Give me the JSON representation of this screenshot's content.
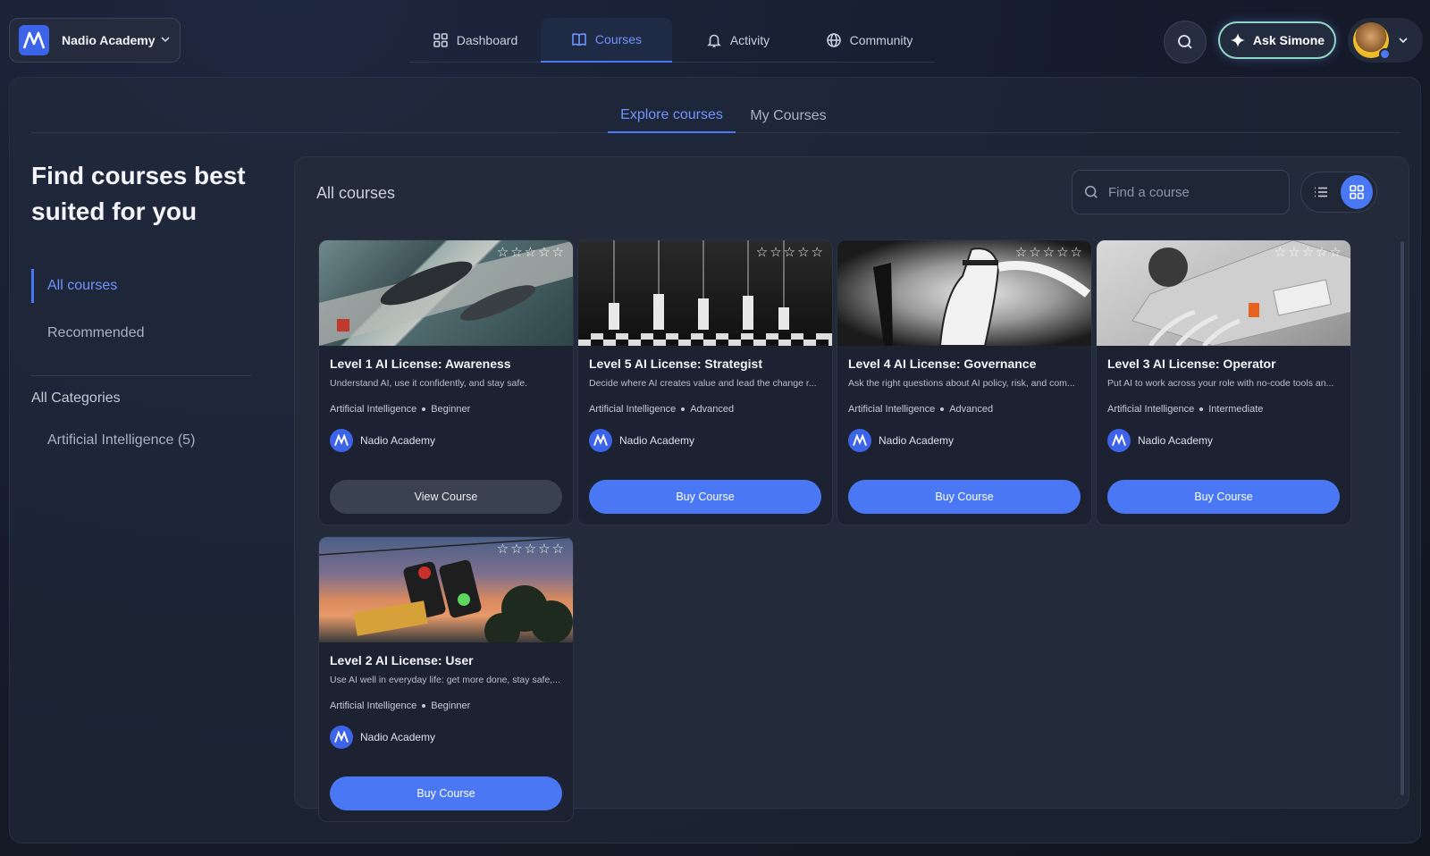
{
  "org": {
    "name": "Nadio Academy"
  },
  "nav": {
    "items": [
      {
        "label": "Dashboard",
        "icon": "dashboard-icon"
      },
      {
        "label": "Courses",
        "icon": "book-icon"
      },
      {
        "label": "Activity",
        "icon": "bell-icon"
      },
      {
        "label": "Community",
        "icon": "globe-icon"
      }
    ],
    "active": "Courses"
  },
  "ask_button": {
    "label": "Ask Simone"
  },
  "subtabs": {
    "explore": "Explore courses",
    "mine": "My Courses"
  },
  "sidebar": {
    "title": "Find courses best suited for you",
    "filters": [
      "All courses",
      "Recommended"
    ],
    "categories_heading": "All Categories",
    "categories": [
      "Artificial Intelligence (5)"
    ]
  },
  "content": {
    "title": "All courses",
    "search_placeholder": "Find a course"
  },
  "courses": [
    {
      "title": "Level 1 AI License: Awareness",
      "desc": "Understand AI, use it confidently, and stay safe.",
      "category": "Artificial Intelligence",
      "level": "Beginner",
      "author": "Nadio Academy",
      "button": "View Course"
    },
    {
      "title": "Level 5 AI License: Strategist",
      "desc": "Decide where AI creates value and lead the change r...",
      "category": "Artificial Intelligence",
      "level": "Advanced",
      "author": "Nadio Academy",
      "button": "Buy Course"
    },
    {
      "title": "Level 4 AI License: Governance",
      "desc": "Ask the right questions about AI policy, risk, and com...",
      "category": "Artificial Intelligence",
      "level": "Advanced",
      "author": "Nadio Academy",
      "button": "Buy Course"
    },
    {
      "title": "Level 3 AI License: Operator",
      "desc": "Put AI to work across your role with no-code tools an...",
      "category": "Artificial Intelligence",
      "level": "Intermediate",
      "author": "Nadio Academy",
      "button": "Buy Course"
    },
    {
      "title": "Level 2 AI License: User",
      "desc": "Use AI well in everyday life: get more done, stay safe,...",
      "category": "Artificial Intelligence",
      "level": "Beginner",
      "author": "Nadio Academy",
      "button": "Buy Course"
    }
  ],
  "colors": {
    "accent": "#4a78f5",
    "accent_text": "#6f95ff",
    "ask_border": "#8fd7c4"
  }
}
